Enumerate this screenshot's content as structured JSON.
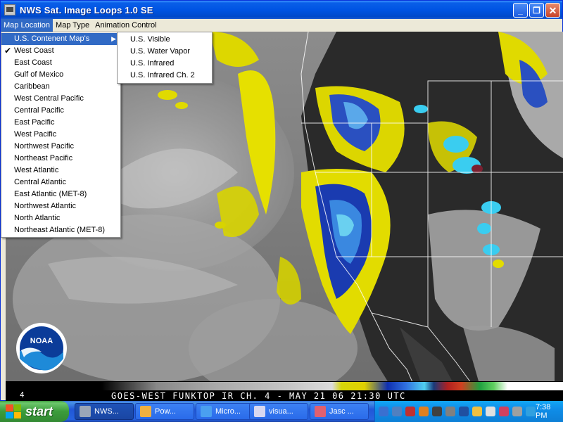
{
  "window": {
    "title": "NWS Sat. Image Loops 1.0 SE",
    "controls": {
      "minimize": "_",
      "maximize": "❐",
      "close": "✕"
    }
  },
  "menubar": {
    "items": [
      "Map Location",
      "Map Type",
      "Animation Control"
    ]
  },
  "map_location_menu": {
    "items": [
      "U.S. Contenent Map's",
      "West Coast",
      "East Coast",
      "Gulf of Mexico",
      "Caribbean",
      "West Central Pacific",
      "Central Pacific",
      "East Pacific",
      "West Pacific",
      "Northwest Pacific",
      "Northeast Pacific",
      "West Atlantic",
      "Central Atlantic",
      "East Atlantic (MET-8)",
      "Northwest Atlantic",
      "North Atlantic",
      "Northeast Atlantic (MET-8)"
    ],
    "checked": "West Coast"
  },
  "submenu": {
    "items": [
      "U.S. Visible",
      "U.S. Water Vapor",
      "U.S. Infrared",
      "U.S. Infrared Ch. 2"
    ]
  },
  "satellite": {
    "logo_text": "NOAA",
    "legend_number": "4",
    "caption": "GOES-WEST FUNKTOP IR CH. 4 - MAY 21 06 21:30 UTC"
  },
  "taskbar": {
    "start_label": "start",
    "tasks": [
      {
        "label": "NWS...",
        "icon": "app-icon",
        "color": "#9aa6b8",
        "active": true
      },
      {
        "label": "Pow...",
        "icon": "powerpoint-icon",
        "color": "#f0b040",
        "active": false
      },
      {
        "label": "Micro...",
        "icon": "window-icon",
        "color": "#4aa0f0",
        "active": false
      },
      {
        "label": "visua...",
        "icon": "visual-icon",
        "color": "#d8d8f0",
        "active": false
      },
      {
        "label": "Jasc ...",
        "icon": "jasc-icon",
        "color": "#e06070",
        "active": false
      }
    ],
    "clock": "7:38 PM"
  }
}
